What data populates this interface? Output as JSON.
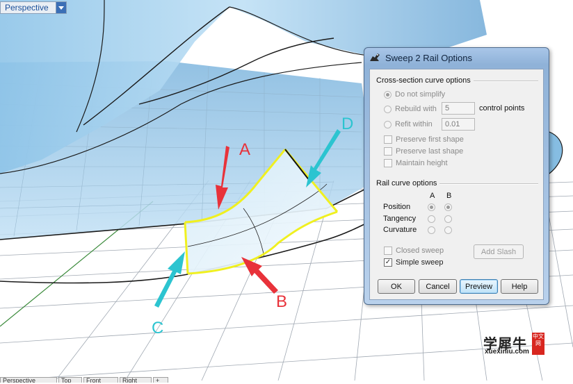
{
  "viewport": {
    "name": "Perspective",
    "annotations": {
      "a": "A",
      "b": "B",
      "c": "C",
      "d": "D"
    }
  },
  "bottom_tabs": [
    "Perspective",
    "Top",
    "Front",
    "Right",
    "+"
  ],
  "dialog": {
    "title": "Sweep 2 Rail Options",
    "cross_section": {
      "title": "Cross-section curve options",
      "do_not_simplify": "Do not simplify",
      "rebuild_with": "Rebuild with",
      "rebuild_value": "5",
      "control_points": "control points",
      "refit_within": "Refit within",
      "refit_value": "0.01",
      "preserve_first": "Preserve first shape",
      "preserve_last": "Preserve last shape",
      "maintain_height": "Maintain height"
    },
    "rail": {
      "title": "Rail curve options",
      "col_a": "A",
      "col_b": "B",
      "position": "Position",
      "tangency": "Tangency",
      "curvature": "Curvature"
    },
    "closed_sweep": "Closed sweep",
    "simple_sweep": "Simple sweep",
    "add_slash": "Add Slash",
    "buttons": {
      "ok": "OK",
      "cancel": "Cancel",
      "preview": "Preview",
      "help": "Help"
    }
  },
  "watermark": {
    "main": "学犀牛",
    "sub": "xuexiniu.com",
    "badge": "中文网"
  },
  "colors": {
    "surface": "#a7d2ee",
    "surface_dark": "#7fb6de",
    "grid": "#9aa4b0",
    "rail_highlight": "#f0f020",
    "arrow_red": "#e8323a",
    "arrow_cyan": "#2cc4d0",
    "dialog_frame": "#9fbfe3"
  }
}
